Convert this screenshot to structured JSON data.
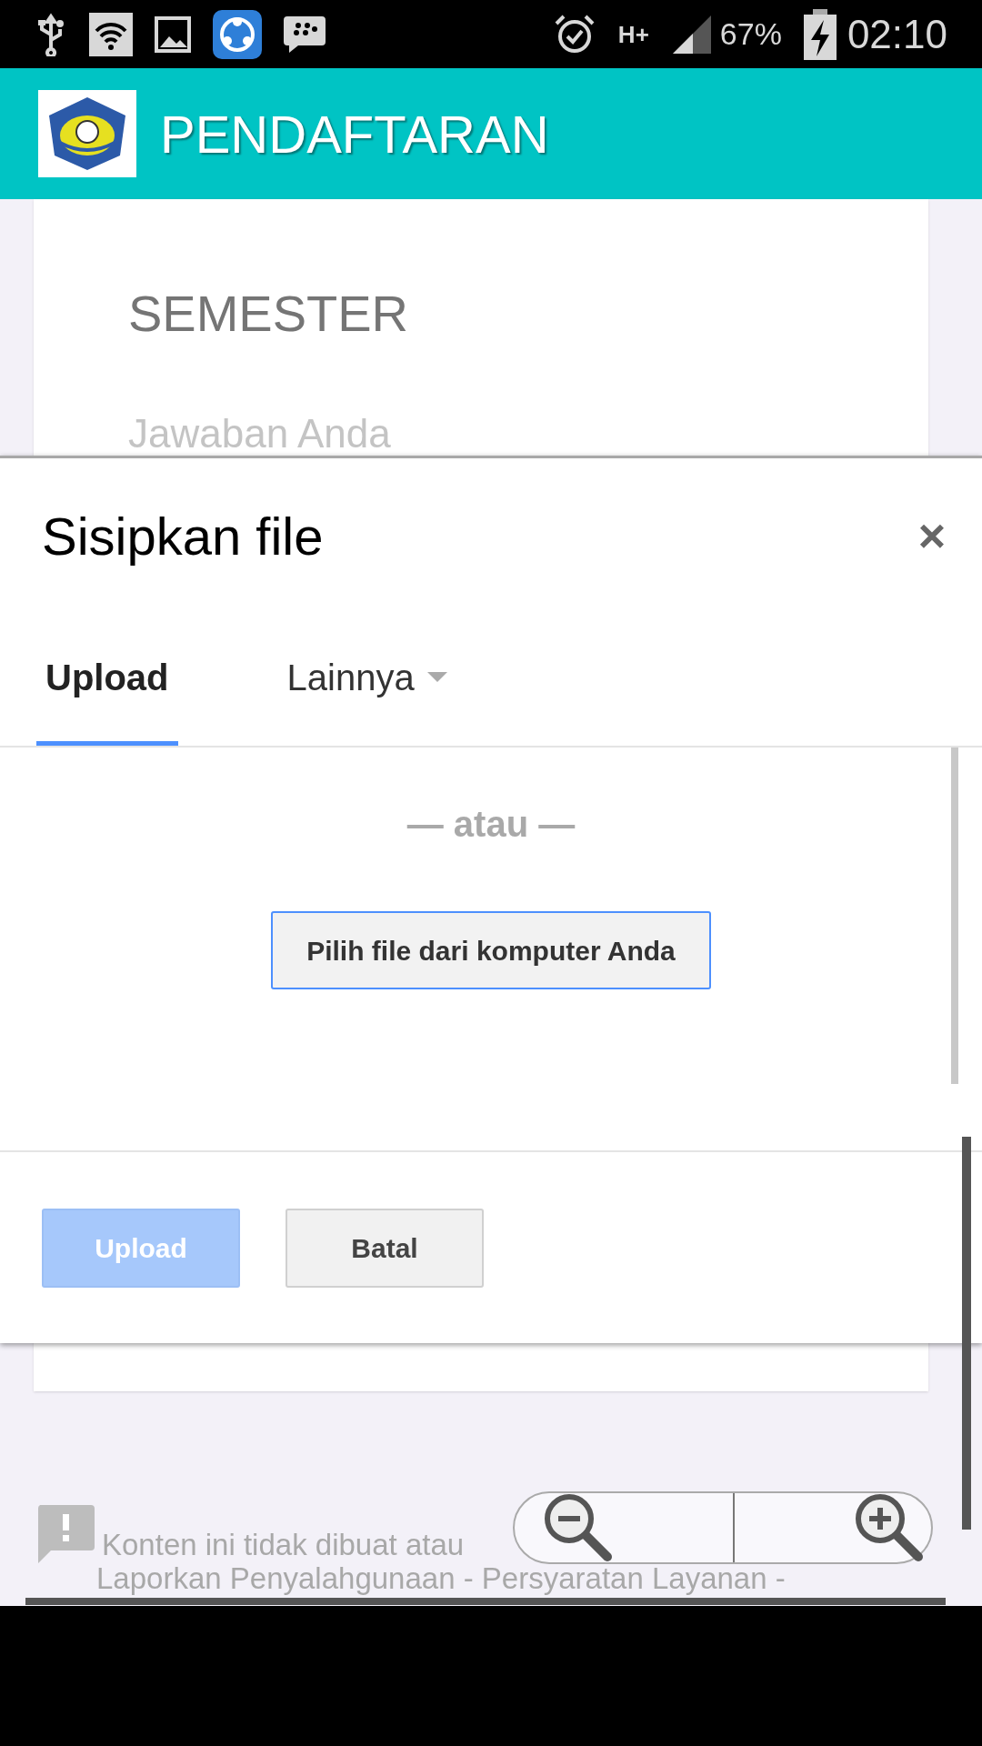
{
  "status_bar": {
    "battery": "67%",
    "time": "02:10",
    "network": "H+"
  },
  "app_bar": {
    "title": "PENDAFTARAN"
  },
  "form_card": {
    "question": "SEMESTER",
    "placeholder": "Jawaban Anda"
  },
  "dialog": {
    "title": "Sisipkan file",
    "close": "×",
    "tabs": [
      {
        "label": "Upload",
        "selected": true,
        "kind": "plain"
      },
      {
        "label": "Lainnya",
        "selected": false,
        "kind": "dropdown"
      }
    ],
    "separator": "— atau —",
    "choose_button": "Pilih file dari komputer Anda",
    "buttons": [
      {
        "label": "Upload",
        "disabled": true
      },
      {
        "label": "Batal",
        "disabled": false
      }
    ]
  },
  "footer": {
    "notice": "Konten ini tidak dibuat atau",
    "links": "Laporkan Penyalahgunaan - Persyaratan Layanan -"
  }
}
